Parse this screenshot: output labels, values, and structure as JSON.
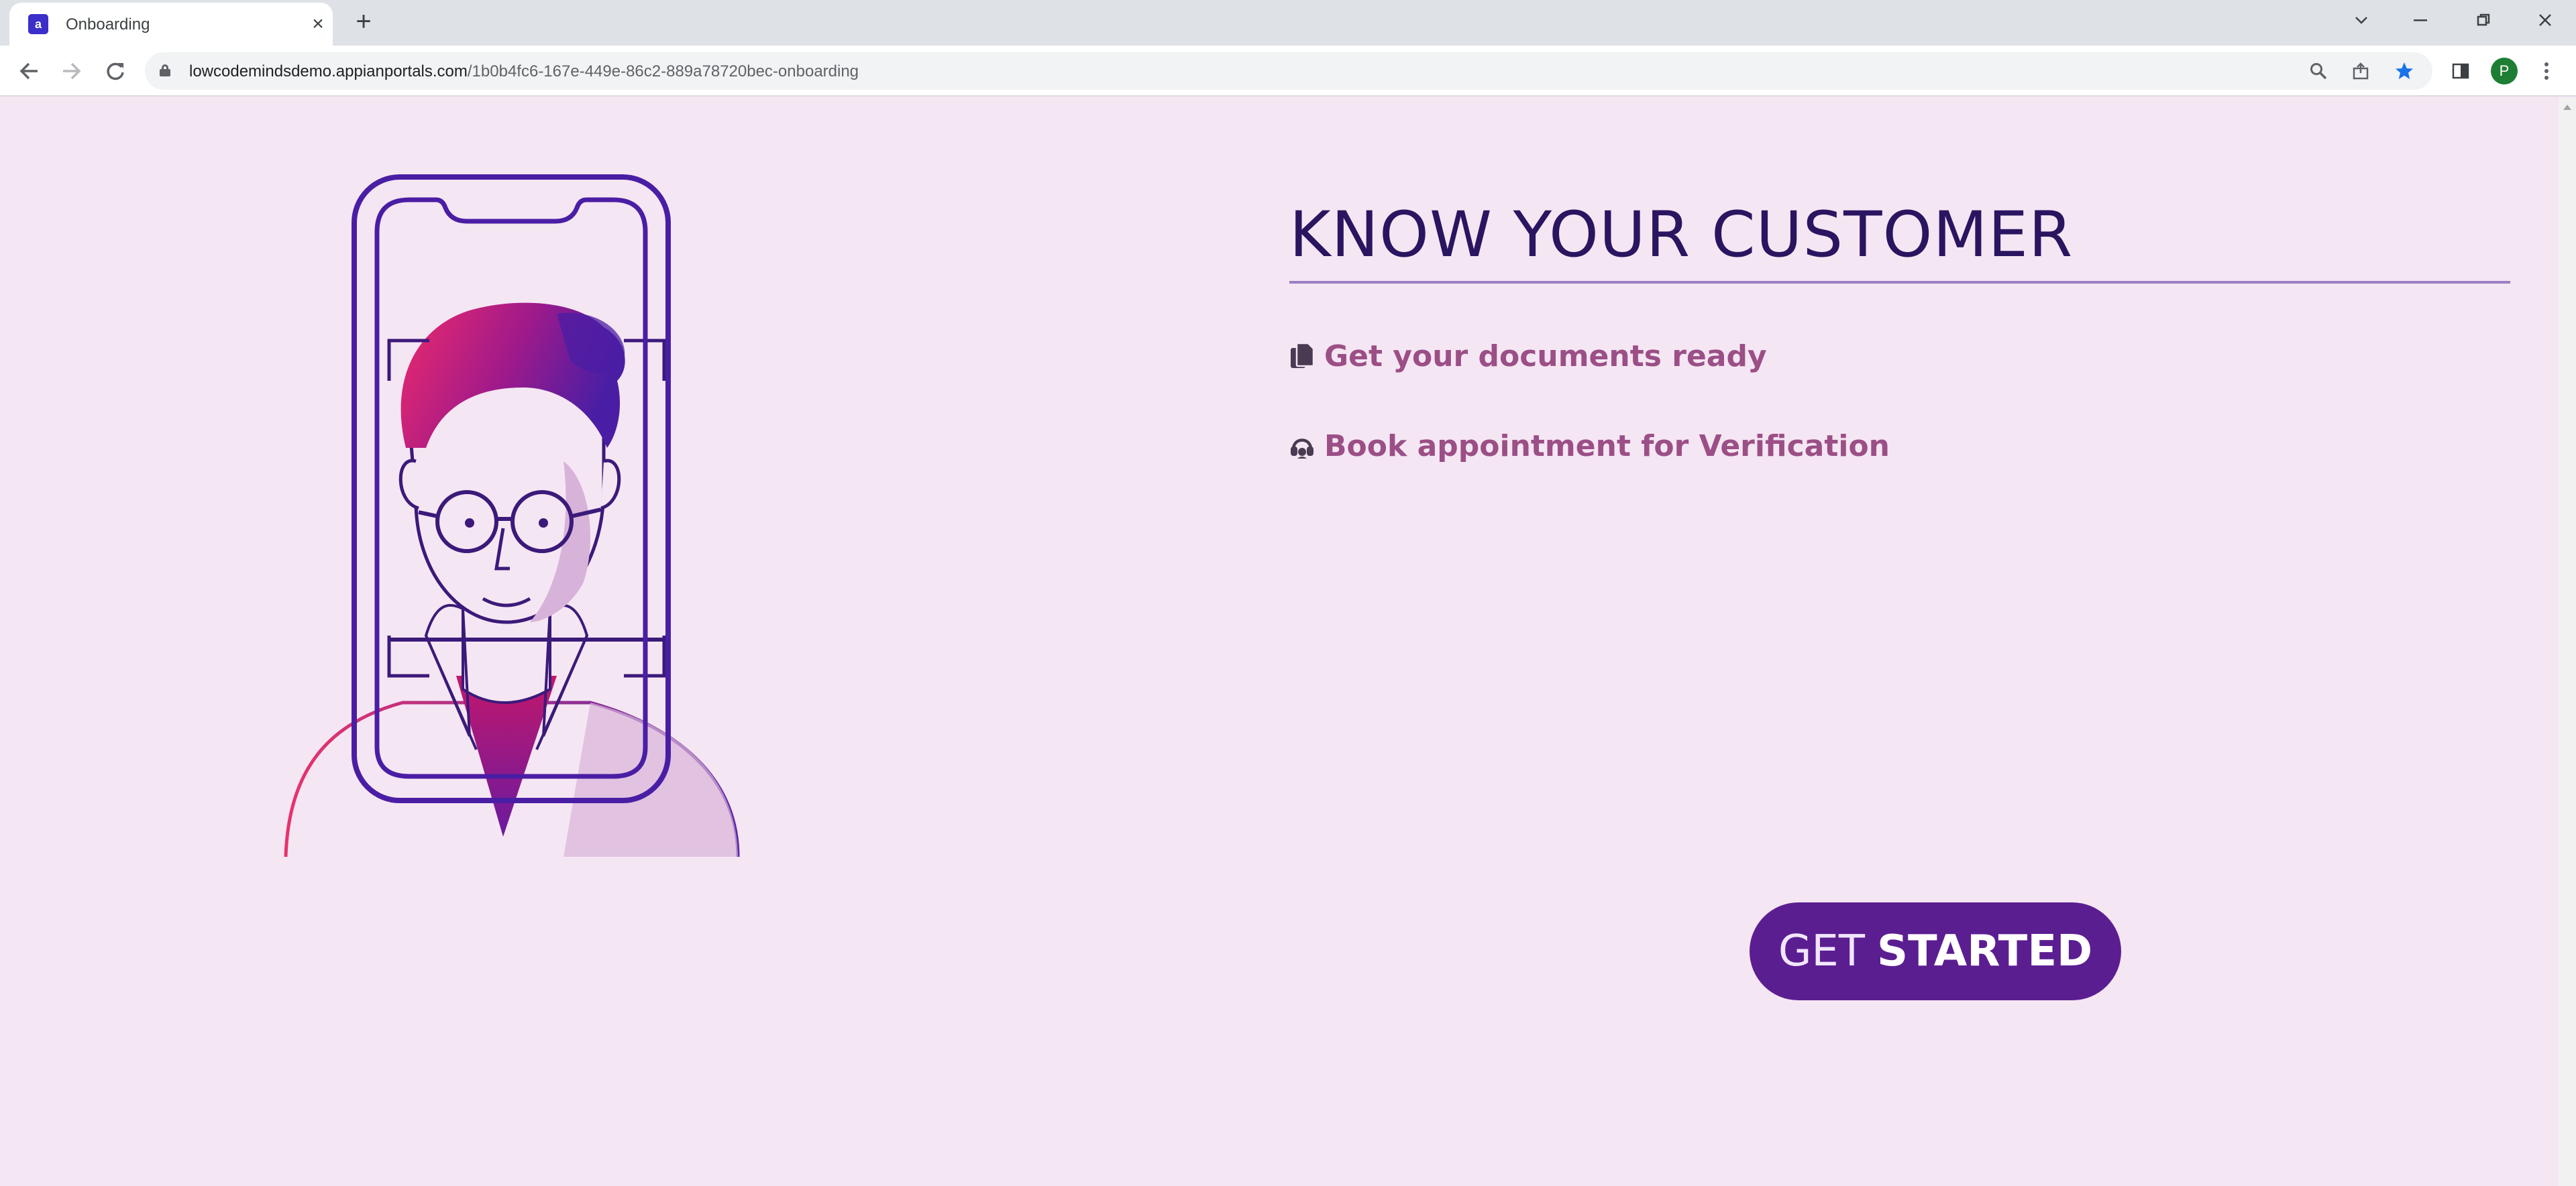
{
  "browser": {
    "tab_title": "Onboarding",
    "favicon_letter": "a",
    "url_host": "lowcodemindsdemo.appianportals.com",
    "url_path": "/1b0b4fc6-167e-449e-86c2-889a78720bec-onboarding",
    "profile_initial": "P"
  },
  "main": {
    "title": "KNOW YOUR CUSTOMER",
    "features": [
      {
        "label": "Get your documents ready",
        "icon": "documents-icon"
      },
      {
        "label": "Book appointment for Verification",
        "icon": "headset-icon"
      }
    ],
    "cta_prefix": "GET",
    "cta_strong": "STARTED"
  },
  "colors": {
    "page_bg": "#f5e6f3",
    "title": "#2a1560",
    "feature_text": "#9b4f86",
    "button_bg": "#5b1e91",
    "rule": "#9b7fc4"
  }
}
